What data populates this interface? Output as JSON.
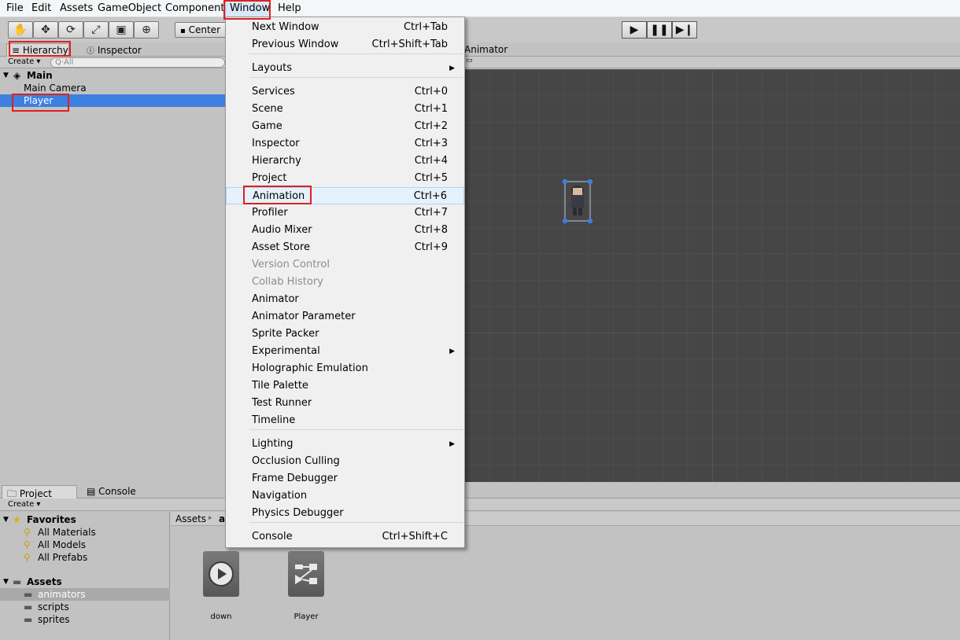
{
  "menubar": {
    "items": [
      "File",
      "Edit",
      "Assets",
      "GameObject",
      "Component",
      "Window",
      "Help"
    ]
  },
  "toolbar": {
    "tools": [
      "hand-icon",
      "move-icon",
      "rotate-icon",
      "scale-icon",
      "rect-icon",
      "transform-icon"
    ],
    "pivot_label": "Center",
    "playback": [
      "play-icon",
      "pause-icon",
      "step-icon"
    ]
  },
  "hierarchy": {
    "tab_label": "Hierarchy",
    "inspector_tab_label": "Inspector",
    "create_label": "Create",
    "search_placeholder": "Q·All",
    "scene_name": "Main",
    "items": [
      "Main Camera",
      "Player"
    ],
    "selected": "Player"
  },
  "scene": {
    "animator_tab_label": "Animator"
  },
  "project": {
    "tab_label": "Project",
    "console_tab_label": "Console",
    "create_label": "Create",
    "favorites_label": "Favorites",
    "favorites": [
      "All Materials",
      "All Models",
      "All Prefabs"
    ],
    "assets_label": "Assets",
    "folders": [
      "animators",
      "scripts",
      "sprites"
    ],
    "selected_folder": "animators",
    "breadcrumb": [
      "Assets",
      "a"
    ],
    "assets": [
      {
        "label": "down",
        "icon": "animation-clip-icon"
      },
      {
        "label": "Player",
        "icon": "animator-controller-icon"
      }
    ]
  },
  "window_menu": {
    "items": [
      {
        "label": "Next Window",
        "shortcut": "Ctrl+Tab"
      },
      {
        "label": "Previous Window",
        "shortcut": "Ctrl+Shift+Tab"
      },
      {
        "label": "Layouts",
        "submenu": true
      },
      {
        "label": "Services",
        "shortcut": "Ctrl+0"
      },
      {
        "label": "Scene",
        "shortcut": "Ctrl+1"
      },
      {
        "label": "Game",
        "shortcut": "Ctrl+2"
      },
      {
        "label": "Inspector",
        "shortcut": "Ctrl+3"
      },
      {
        "label": "Hierarchy",
        "shortcut": "Ctrl+4"
      },
      {
        "label": "Project",
        "shortcut": "Ctrl+5"
      },
      {
        "label": "Animation",
        "shortcut": "Ctrl+6",
        "highlighted": true
      },
      {
        "label": "Profiler",
        "shortcut": "Ctrl+7"
      },
      {
        "label": "Audio Mixer",
        "shortcut": "Ctrl+8"
      },
      {
        "label": "Asset Store",
        "shortcut": "Ctrl+9"
      },
      {
        "label": "Version Control",
        "disabled": true
      },
      {
        "label": "Collab History",
        "disabled": true
      },
      {
        "label": "Animator"
      },
      {
        "label": "Animator Parameter"
      },
      {
        "label": "Sprite Packer"
      },
      {
        "label": "Experimental",
        "submenu": true
      },
      {
        "label": "Holographic Emulation"
      },
      {
        "label": "Tile Palette"
      },
      {
        "label": "Test Runner"
      },
      {
        "label": "Timeline"
      },
      {
        "label": "Lighting",
        "submenu": true
      },
      {
        "label": "Occlusion Culling"
      },
      {
        "label": "Frame Debugger"
      },
      {
        "label": "Navigation"
      },
      {
        "label": "Physics Debugger"
      },
      {
        "label": "Console",
        "shortcut": "Ctrl+Shift+C"
      }
    ]
  },
  "colors": {
    "selection_blue": "#3d80df",
    "highlight_red": "#e02020",
    "scene_bg": "#464646"
  }
}
